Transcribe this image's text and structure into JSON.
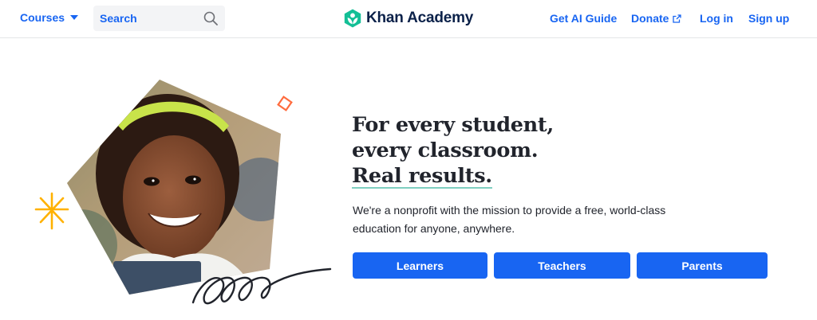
{
  "header": {
    "courses_label": "Courses",
    "search": {
      "placeholder": "Search"
    },
    "brand_name": "Khan Academy",
    "links": {
      "ai_guide": "Get AI Guide",
      "donate": "Donate",
      "login": "Log in",
      "signup": "Sign up"
    }
  },
  "hero": {
    "headline": [
      "For every student,",
      "every classroom.",
      "Real results."
    ],
    "tagline": "We're a nonprofit with the mission to provide a free, world-class education for anyone, anywhere.",
    "buttons": {
      "learners": "Learners",
      "teachers": "Teachers",
      "parents": "Parents"
    }
  },
  "colors": {
    "accent": "#1865f2",
    "brand_navy": "#0b2149",
    "brand_green": "#14bf96",
    "underline": "#7fcfc0",
    "spark": "#ffb100",
    "diamond": "#ff6b3d"
  },
  "icons": [
    "chevron-down-icon",
    "search-icon",
    "khan-logo-icon",
    "external-link-icon",
    "sparkle-icon",
    "diamond-icon",
    "squiggle-icon"
  ]
}
